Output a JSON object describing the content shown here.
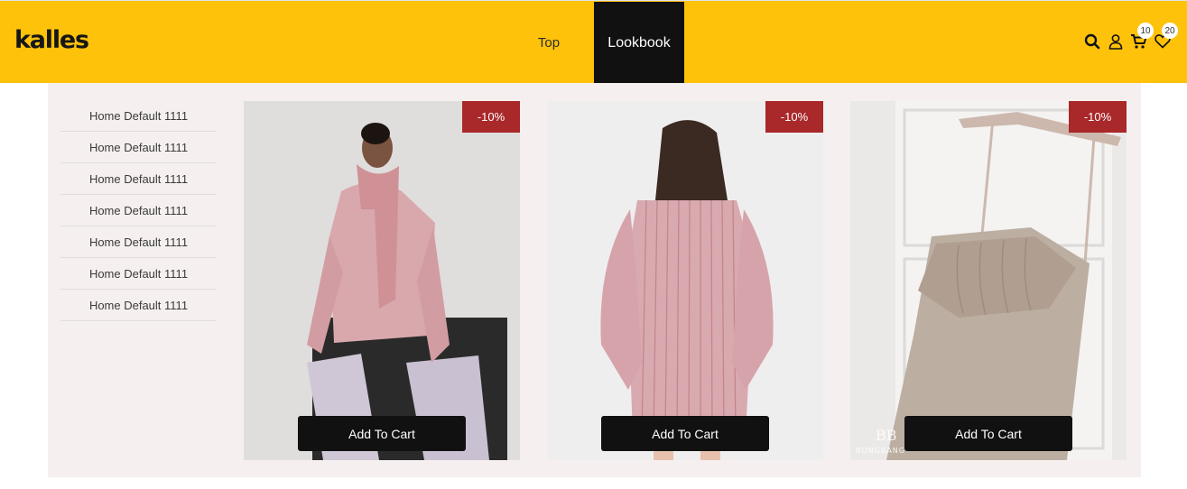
{
  "header": {
    "logo": "kalles",
    "nav": [
      {
        "label": "Top"
      },
      {
        "label": "Lookbook"
      }
    ],
    "cart_count": "10",
    "wishlist_count": "20",
    "colors": {
      "background": "#fec20a",
      "active_nav": "#111111"
    }
  },
  "sidebar": {
    "items": [
      {
        "label": "Home Default 1111"
      },
      {
        "label": "Home Default 1111"
      },
      {
        "label": "Home Default 1111"
      },
      {
        "label": "Home Default 1111"
      },
      {
        "label": "Home Default 1111"
      },
      {
        "label": "Home Default 1111"
      },
      {
        "label": "Home Default 1111"
      }
    ]
  },
  "products": [
    {
      "badge": "-10%",
      "button": "Add To Cart",
      "image": "pink-sweater-scarf-model"
    },
    {
      "badge": "-10%",
      "button": "Add To Cart",
      "image": "striped-pink-dress-back"
    },
    {
      "badge": "-10%",
      "button": "Add To Cart",
      "image": "beige-dress-on-hanger"
    }
  ],
  "icons": [
    "search-icon",
    "user-icon",
    "cart-icon",
    "heart-icon"
  ],
  "colors": {
    "badge": "#a9282a",
    "button": "#111111",
    "content_bg": "#f5f0ef"
  }
}
